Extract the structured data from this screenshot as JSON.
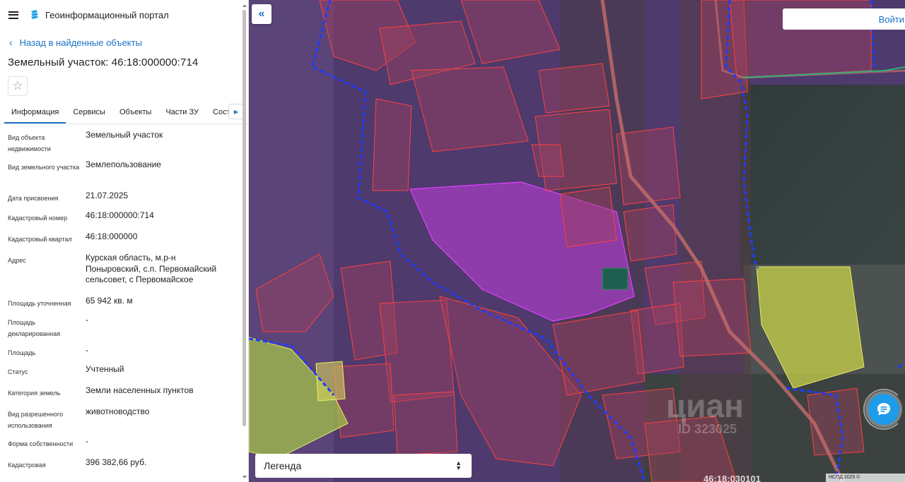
{
  "header": {
    "portal_title": "Геоинформационный портал"
  },
  "nav": {
    "back_label": "Назад в найденные объекты"
  },
  "object": {
    "title": "Земельный участок: 46:18:000000:714"
  },
  "tabs": [
    {
      "label": "Информация",
      "active": true
    },
    {
      "label": "Сервисы"
    },
    {
      "label": "Объекты"
    },
    {
      "label": "Части ЗУ"
    },
    {
      "label": "Соста"
    }
  ],
  "info_rows": [
    {
      "label": "Вид объекта недвижимости",
      "value": "Земельный участок"
    },
    {
      "label": "Вид земельного участка",
      "value": "Землепользование"
    },
    {
      "label": "Дата присвоения",
      "value": "21.07.2025"
    },
    {
      "label": "Кадастровый номер",
      "value": "46:18:000000:714"
    },
    {
      "label": "Кадастровый квартал",
      "value": "46:18:000000"
    },
    {
      "label": "Адрес",
      "value": "Курская область, м.р-н Поныровский, с.п. Первомайский сельсовет, с Первомайское"
    },
    {
      "label": "Площадь уточненная",
      "value": "65 942 кв. м"
    },
    {
      "label": "Площадь декларированная",
      "value": "-"
    },
    {
      "label": "Площадь",
      "value": "-"
    },
    {
      "label": "Статус",
      "value": "Учтенный"
    },
    {
      "label": "Категория земель",
      "value": "Земли населенных пунктов"
    },
    {
      "label": "Вид разрешенного использования",
      "value": "животноводство"
    },
    {
      "label": "Форма собственности",
      "value": "-"
    },
    {
      "label": "Кадастровая",
      "value": "396 382,66 руб."
    }
  ],
  "map": {
    "login_label": "Войти",
    "legend_label": "Легенда",
    "watermark": "циан",
    "watermark_id": "ID 323025",
    "copyright": "НСПД 2025 ©",
    "parcel_label": "46:18:030101"
  },
  "colors": {
    "accent": "#1a73c8",
    "parcel_outline": "#e0393c",
    "selected_parcel": "#c03ce0",
    "boundary": "#1f3cff",
    "chat": "#1e9be9"
  }
}
